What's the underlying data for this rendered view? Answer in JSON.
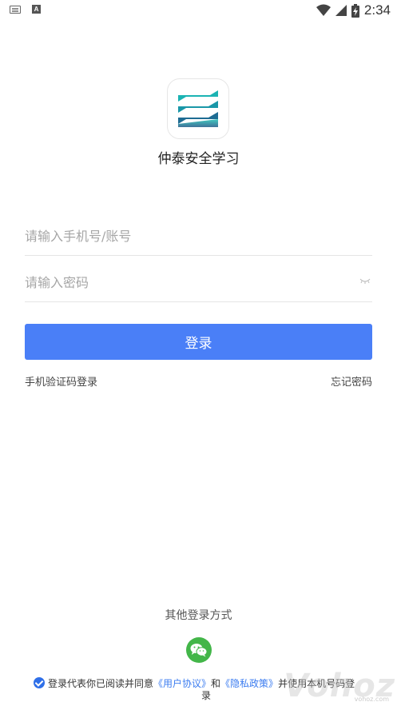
{
  "status_bar": {
    "time": "2:34",
    "icons": [
      "keyboard-icon",
      "a-notification-icon",
      "wifi-icon",
      "cell-signal-icon",
      "battery-charging-icon"
    ]
  },
  "app": {
    "name": "仲泰安全学习"
  },
  "login_form": {
    "account_placeholder": "请输入手机号/账号",
    "password_placeholder": "请输入密码",
    "login_label": "登录",
    "sms_login_label": "手机验证码登录",
    "forgot_password_label": "忘记密码"
  },
  "other_login": {
    "title": "其他登录方式",
    "methods": [
      "wechat-icon"
    ]
  },
  "agreement": {
    "prefix": "登录代表你已阅读并同意",
    "user_agreement": "《用户协议》",
    "and": "和",
    "privacy_policy": "《隐私政策》",
    "suffix_line1": "并使用本机号码登",
    "suffix_line2": "录"
  },
  "watermark": {
    "text": "Vohoz",
    "url": "vohoz.com"
  },
  "colors": {
    "primary": "#4a7ff7",
    "link": "#3b7cf0",
    "wechat": "#43b649",
    "logo_teal": "#1bb3b3",
    "logo_dark": "#1e5a87"
  }
}
